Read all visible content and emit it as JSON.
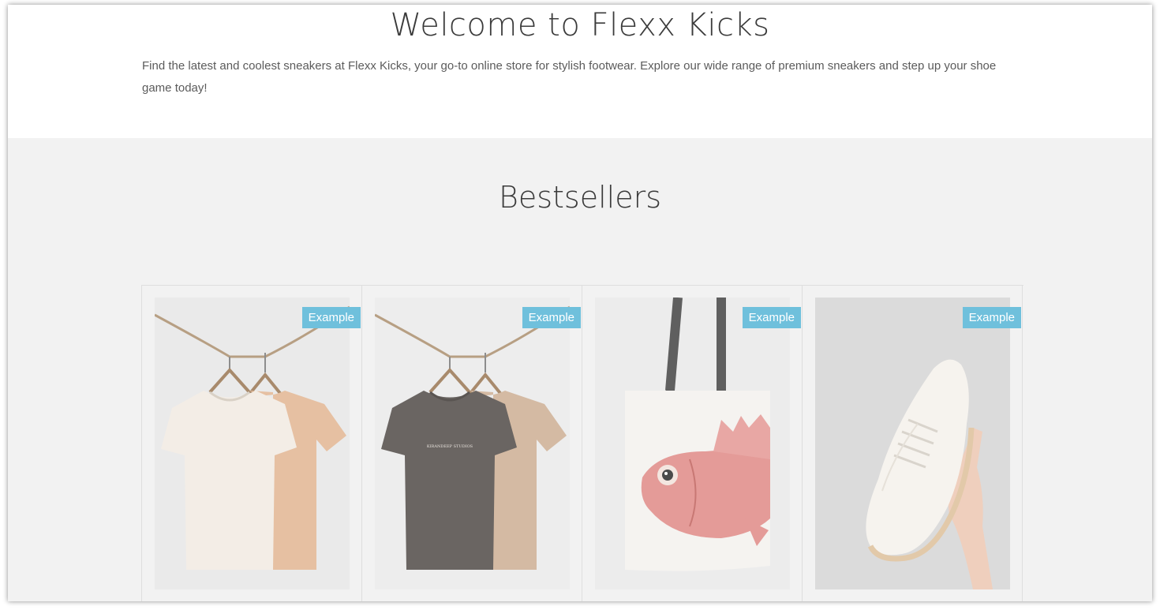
{
  "hero": {
    "title": "Welcome to Flexx Kicks",
    "description": "Find the latest and coolest sneakers at Flexx Kicks, your go-to online store for stylish footwear. Explore our wide range of premium sneakers and step up your shoe game today!"
  },
  "bestsellers": {
    "title": "Bestsellers",
    "products": [
      {
        "badge": "Example",
        "image": "cream-and-peach-tshirts-on-hangers"
      },
      {
        "badge": "Example",
        "image": "charcoal-and-tan-tshirts-on-hangers",
        "shirt_print": "KIRANDEEP STUDIOS"
      },
      {
        "badge": "Example",
        "image": "white-tote-bag-with-pink-fish"
      },
      {
        "badge": "Example",
        "image": "hand-holding-white-sneaker"
      }
    ]
  },
  "colors": {
    "badge": "#6fc0dc",
    "section_bg": "#f2f2f2",
    "heading": "#3b3b3b"
  }
}
